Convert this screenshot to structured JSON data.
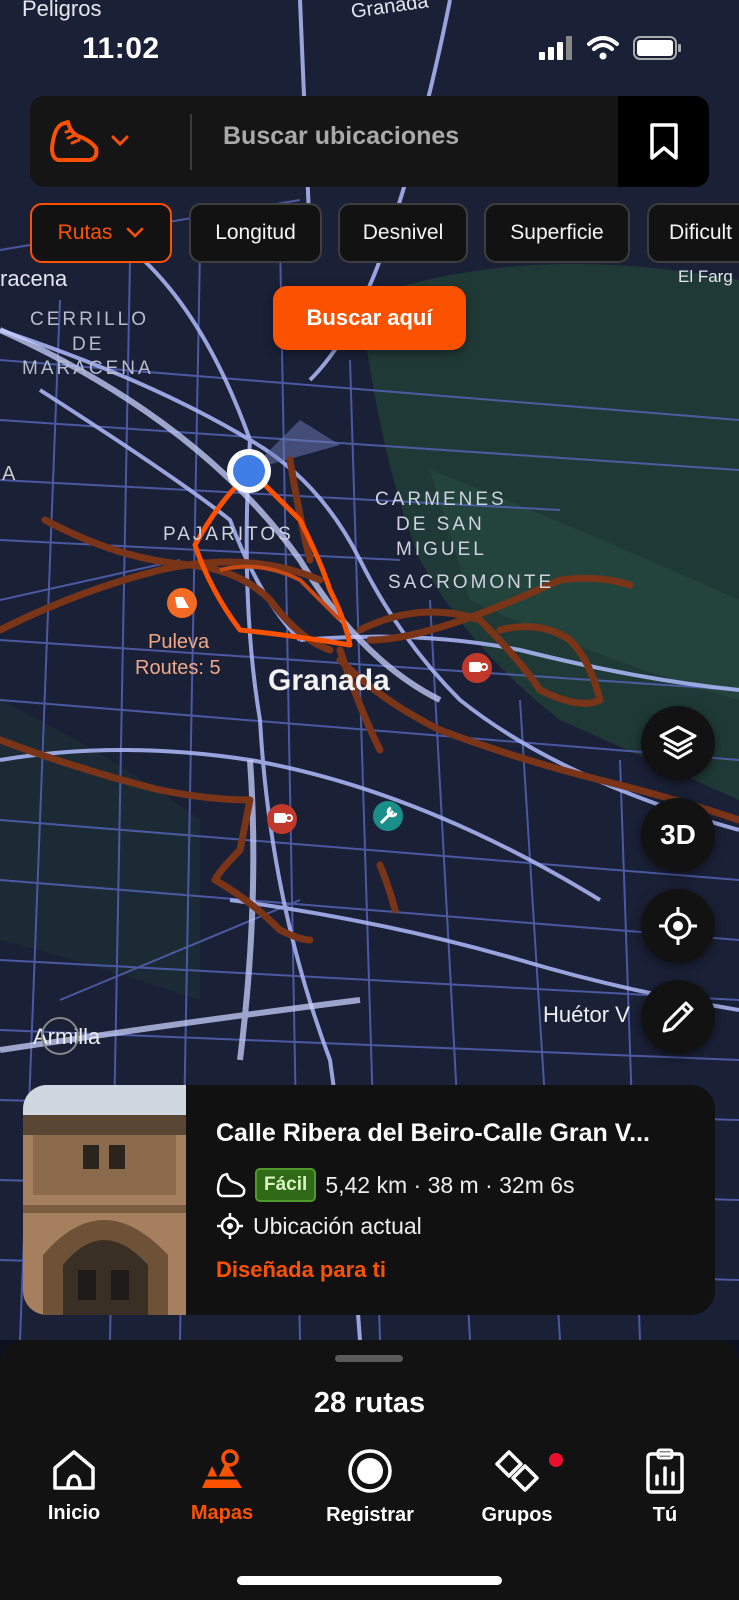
{
  "status_bar": {
    "time": "11:02"
  },
  "search": {
    "placeholder": "Buscar ubicaciones",
    "sport_icon": "running-shoe-icon"
  },
  "filters": [
    "Rutas",
    "Longitud",
    "Desnivel",
    "Superficie",
    "Dificult"
  ],
  "search_here_label": "Buscar aquí",
  "map": {
    "labels": [
      {
        "text": "Peligros",
        "style": "town"
      },
      {
        "text": "Granada",
        "style": "road"
      },
      {
        "text": "racena",
        "style": "town"
      },
      {
        "text": "El Farg",
        "style": "small"
      },
      {
        "text": "CERRILLO",
        "style": "district"
      },
      {
        "text": "DE",
        "style": "district"
      },
      {
        "text": "MARACENA",
        "style": "district"
      },
      {
        "text": "PAJARITOS",
        "style": "district"
      },
      {
        "text": "CARMENES",
        "style": "district"
      },
      {
        "text": "DE SAN",
        "style": "district"
      },
      {
        "text": "MIGUEL",
        "style": "district"
      },
      {
        "text": "SACROMONTE",
        "style": "district"
      },
      {
        "text": "Puleva",
        "style": "poi"
      },
      {
        "text": "Routes: 5",
        "style": "poi"
      },
      {
        "text": "Granada",
        "style": "city"
      },
      {
        "text": "Huétor V",
        "style": "town"
      },
      {
        "text": "Armilla",
        "style": "town"
      },
      {
        "text": "A",
        "style": "town"
      }
    ],
    "pois": [
      "route-hub-icon",
      "cafe-icon",
      "cafe-icon",
      "bike-repair-icon"
    ]
  },
  "map_controls": {
    "layers_icon": "layers-icon",
    "three_d_label": "3D",
    "locate_icon": "crosshair-icon",
    "draw_icon": "pencil-icon"
  },
  "route_card": {
    "title": "Calle Ribera del Beiro-Calle Gran V...",
    "difficulty": "Fácil",
    "stats": "5,42 km · 38 m · 32m  6s",
    "start": "Ubicación actual",
    "tag": "Diseñada para ti"
  },
  "results_count": "28 rutas",
  "nav": [
    {
      "label": "Inicio",
      "icon": "home-icon"
    },
    {
      "label": "Mapas",
      "icon": "maps-icon"
    },
    {
      "label": "Registrar",
      "icon": "record-icon"
    },
    {
      "label": "Grupos",
      "icon": "groups-icon"
    },
    {
      "label": "Tú",
      "icon": "profile-icon"
    }
  ],
  "colors": {
    "accent": "#fc5200",
    "map_bg": "#1b2238",
    "road": "#8e9be8",
    "route": "#7a3417",
    "surface": "#121212"
  }
}
